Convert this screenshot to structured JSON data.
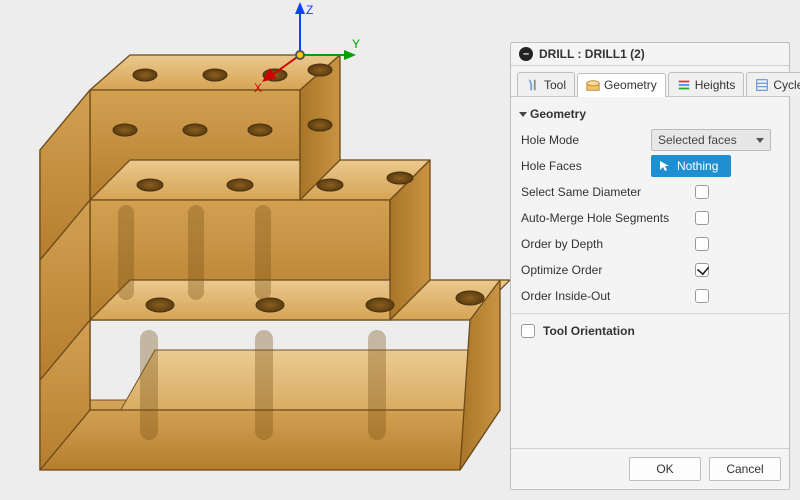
{
  "panel": {
    "title": "DRILL : DRILL1 (2)",
    "tabs": {
      "tool": {
        "label": "Tool",
        "active": false
      },
      "geometry": {
        "label": "Geometry",
        "active": true
      },
      "heights": {
        "label": "Heights",
        "active": false
      },
      "cycle": {
        "label": "Cycle",
        "active": false
      }
    },
    "section_header": "Geometry",
    "rows": {
      "hole_mode": {
        "label": "Hole Mode",
        "value": "Selected faces"
      },
      "hole_faces": {
        "label": "Hole Faces",
        "chip_value": "Nothing"
      },
      "same_dia": {
        "label": "Select Same Diameter",
        "checked": false
      },
      "auto_merge": {
        "label": "Auto-Merge Hole Segments",
        "checked": false
      },
      "by_depth": {
        "label": "Order by Depth",
        "checked": false
      },
      "opt_order": {
        "label": "Optimize Order",
        "checked": true
      },
      "inside_out": {
        "label": "Order Inside-Out",
        "checked": false
      }
    },
    "tool_orientation": {
      "label": "Tool Orientation",
      "checked": false
    },
    "buttons": {
      "ok": "OK",
      "cancel": "Cancel"
    }
  },
  "axes": {
    "x": "X",
    "y": "Y",
    "z": "Z"
  },
  "colors": {
    "panel_bg": "#f4f4f4",
    "chip_bg": "#1e90d2",
    "model_fill": "#d8a558",
    "model_fill_light": "#eac98e",
    "model_edge": "#6c4a1a"
  }
}
